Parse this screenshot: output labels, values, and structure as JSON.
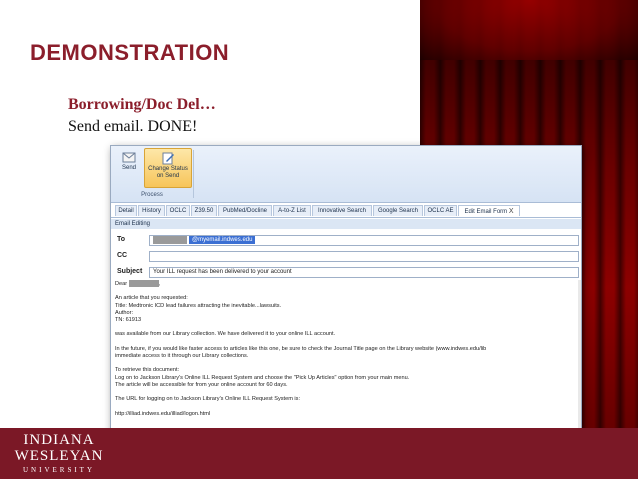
{
  "slide": {
    "title": "DEMONSTRATION",
    "subtitle": "Borrowing/Doc Del…",
    "line": "Send email.  DONE!"
  },
  "logo": {
    "line1": "INDIANA",
    "line2": "WESLEYAN",
    "line3": "UNIVERSITY"
  },
  "colors": {
    "accent": "#8b1e2b",
    "footer": "#7b1826",
    "curtain": "#8c0000",
    "highlight": "#f7c55a"
  },
  "ribbon": {
    "send_label": "Send",
    "change_status_label_1": "Change Status",
    "change_status_label_2": "on Send",
    "group_label": "Process",
    "send_icon": "mail-send-icon",
    "change_status_icon": "edit-status-icon"
  },
  "tabs": [
    "Detail",
    "History",
    "OCLC",
    "Z39.50",
    "PubMed/Docline",
    "A-to-Z List",
    "Innovative Search",
    "Google Search",
    "OCLC AE",
    "Edit Email Form"
  ],
  "tab_close": "X",
  "section": "Email Editing",
  "fields": {
    "to_label": "To",
    "to_value": "@myemail.indwes.edu",
    "cc_label": "CC",
    "cc_value": "",
    "subject_label": "Subject",
    "subject_value": "Your ILL request has been delivered to your account"
  },
  "message": {
    "dear": "Dear",
    "dear_suffix": ",",
    "lines": [
      "An article that you requested:",
      "Title: Medtronic ICD lead failures attracting the inevitable...lawsuits.",
      "Author:",
      "TN: 61913",
      "",
      "was available from our Library collection.  We have delivered it to your online ILL account.",
      "",
      "In the future, if you would like faster access to articles like this one, be sure to check the Journal Title page on the Library website (www.indwes.edu/lib",
      "immediate access to it through our Library collections.",
      "",
      "To retrieve this document:",
      "Log on to Jackson Library's Online ILL Request System and choose the \"Pick Up Articles\" option from your main menu.",
      "The article will be accessible for from your online account for 60 days.",
      "",
      "The URL for logging on to Jackson Library's Online ILL Request System is:",
      "",
      "http://illiad.indwes.edu/illiad/logon.html"
    ]
  }
}
